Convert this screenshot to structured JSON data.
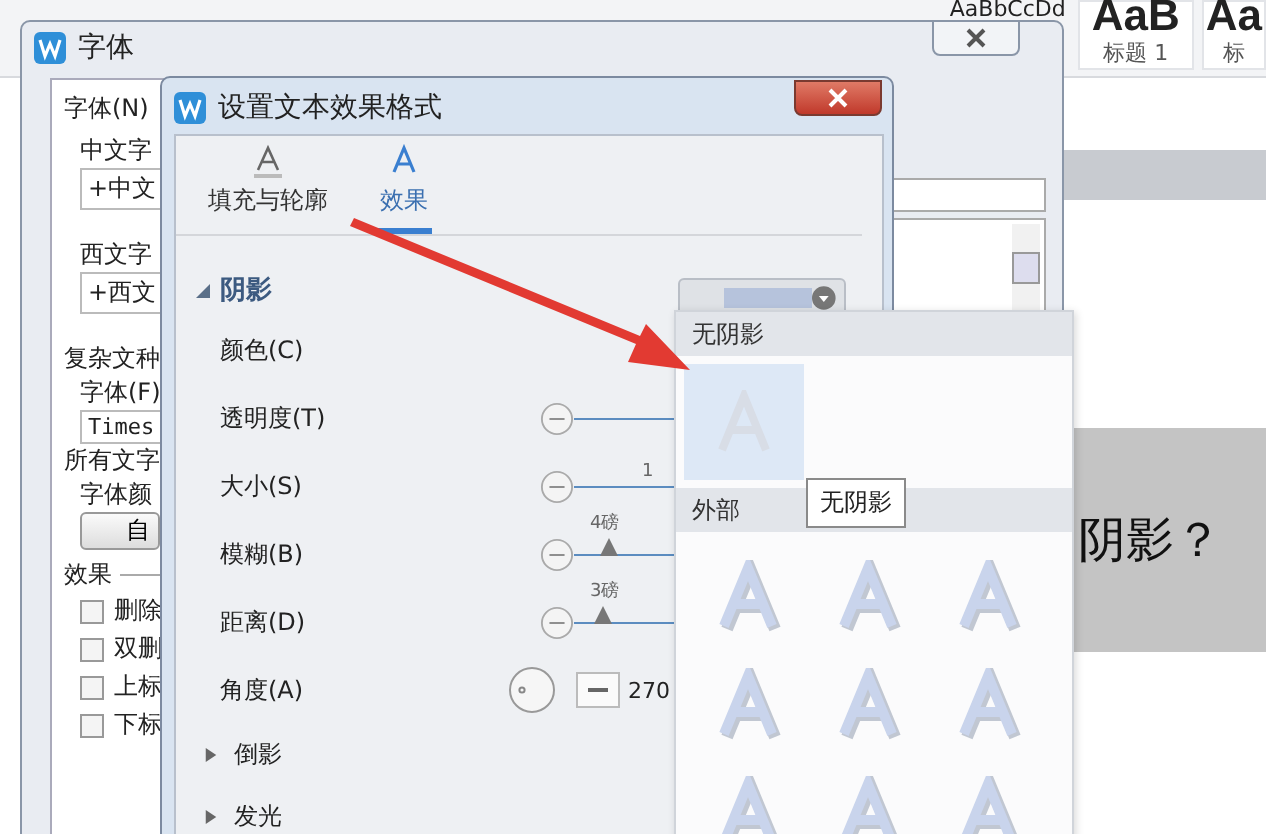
{
  "ribbon": {
    "style_preview": "AaBbCcDd",
    "styles": [
      {
        "preview": "AaB",
        "name": "标题 1"
      },
      {
        "preview": "Aa",
        "name": "标"
      }
    ]
  },
  "document": {
    "text": "阴影？"
  },
  "font_dialog": {
    "title": "字体",
    "tab": "字体(N)",
    "fields": [
      {
        "label": "中文字",
        "value": "+中文"
      },
      {
        "label": "西文字",
        "value": "+西文"
      }
    ],
    "complex": {
      "heading": "复杂文种",
      "label": "字体(F)",
      "value": "Times"
    },
    "all_text": {
      "heading": "所有文字",
      "label": "字体颜",
      "button": "自"
    },
    "effects": {
      "heading": "效果",
      "options": [
        {
          "label": "删除",
          "checked": false
        },
        {
          "label": "双删",
          "checked": false
        },
        {
          "label": "上标",
          "checked": false
        },
        {
          "label": "下标",
          "checked": false
        }
      ]
    }
  },
  "effects_dialog": {
    "title": "设置文本效果格式",
    "tabs": [
      {
        "label": "填充与轮廓",
        "selected": false
      },
      {
        "label": "效果",
        "selected": true
      }
    ],
    "section": {
      "title": "阴影",
      "expanded": true
    },
    "rows": [
      {
        "kind": "color",
        "label": "颜色(C)"
      },
      {
        "kind": "slider",
        "label": "透明度(T)"
      },
      {
        "kind": "slider",
        "label": "大小(S)",
        "reading": "1"
      },
      {
        "kind": "slider",
        "label": "模糊(B)",
        "reading": "4磅",
        "level": 0.12
      },
      {
        "kind": "slider",
        "label": "距离(D)",
        "reading": "3磅",
        "level": 0.1
      },
      {
        "kind": "angle",
        "label": "角度(A)",
        "value": "270"
      }
    ],
    "collapsed": [
      {
        "title": "倒影",
        "expanded": false
      },
      {
        "title": "发光",
        "expanded": false
      }
    ]
  },
  "shadow_popup": {
    "header": "无阴影",
    "none_selected": true,
    "tooltip": "无阴影",
    "section": "外部",
    "presets": [
      {
        "selected": false
      },
      {
        "selected": false
      },
      {
        "selected": false
      },
      {
        "selected": false
      },
      {
        "selected": false
      },
      {
        "selected": false
      },
      {
        "selected": false
      },
      {
        "selected": false
      },
      {
        "selected": false
      }
    ]
  }
}
